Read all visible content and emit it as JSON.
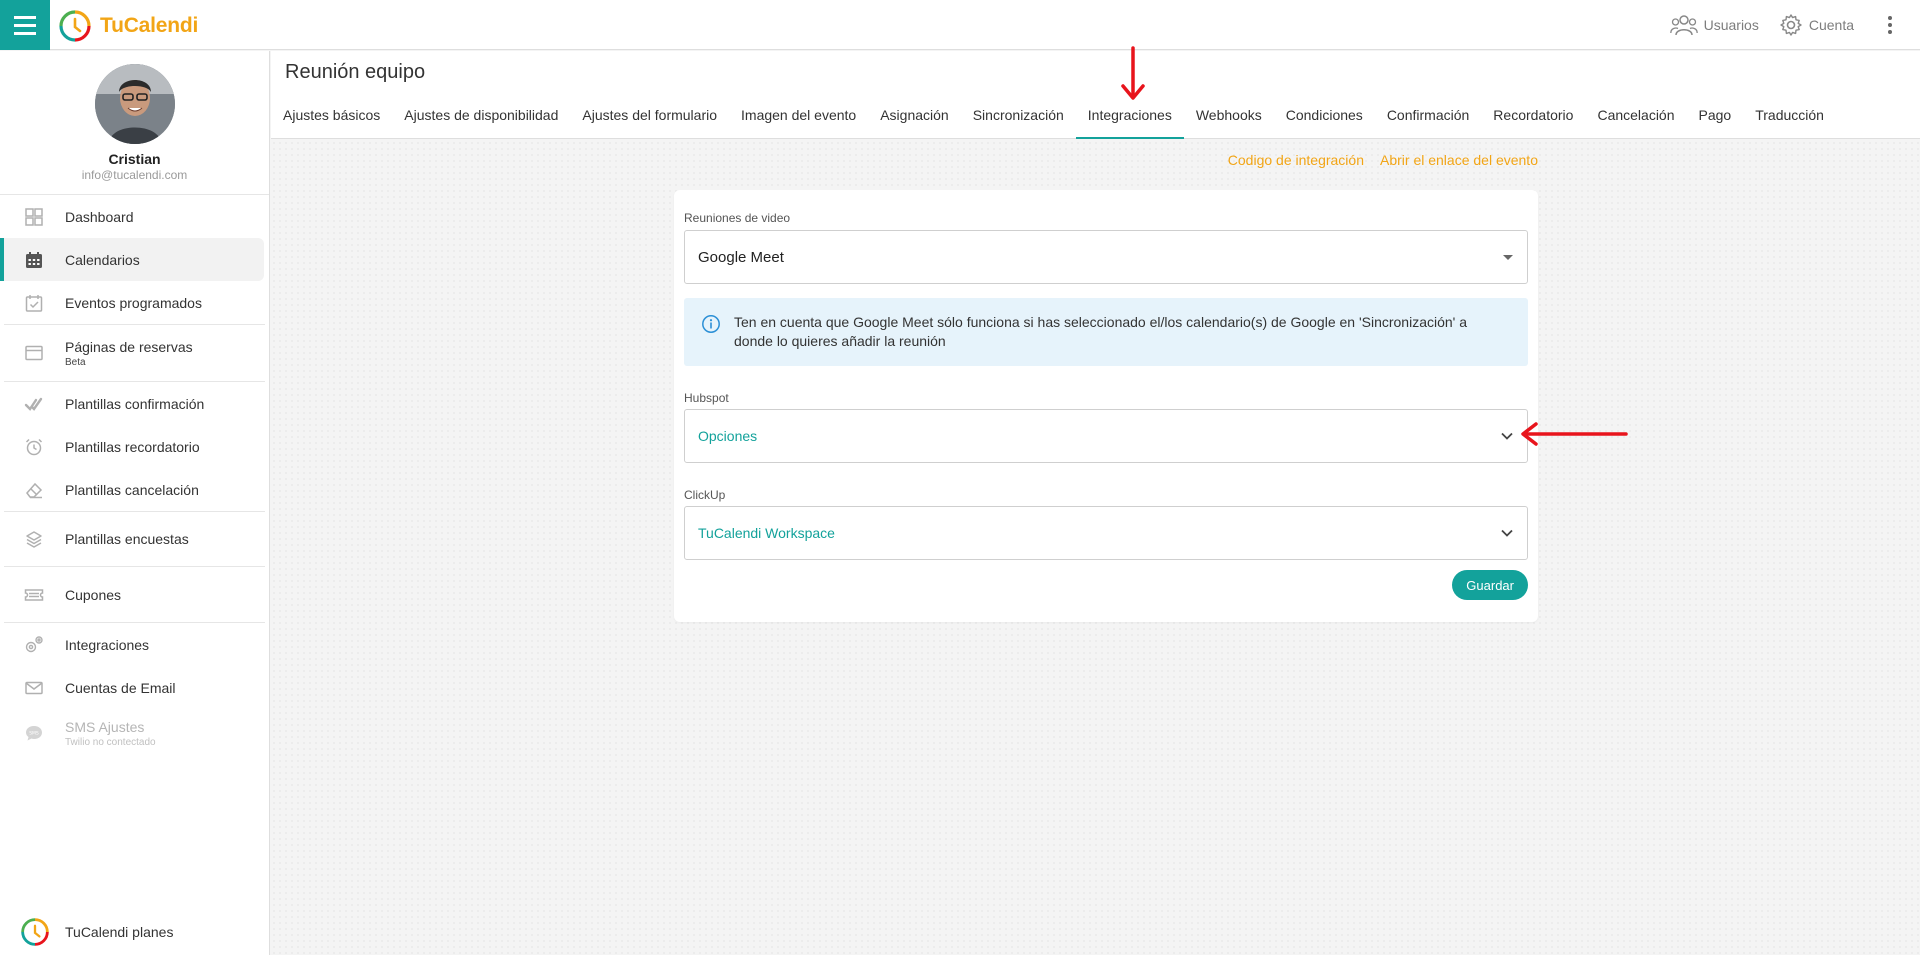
{
  "app": {
    "brand_part1": "TuCalend",
    "brand_part2": "i",
    "top_users": "Usuarios",
    "top_account": "Cuenta"
  },
  "profile": {
    "name": "Cristian",
    "email": "info@tucalendi.com"
  },
  "sidebar": {
    "items": [
      {
        "label": "Dashboard",
        "icon": "grid-icon"
      },
      {
        "label": "Calendarios",
        "icon": "calendar-icon",
        "active": true
      },
      {
        "label": "Eventos programados",
        "icon": "calendar-check-icon"
      },
      {
        "label": "Páginas de reservas",
        "sub": "Beta",
        "icon": "browser-window-icon"
      },
      {
        "label": "Plantillas confirmación",
        "icon": "double-check-icon"
      },
      {
        "label": "Plantillas recordatorio",
        "icon": "alarm-clock-icon"
      },
      {
        "label": "Plantillas cancelación",
        "icon": "eraser-icon"
      },
      {
        "label": "Plantillas encuestas",
        "icon": "layers-icon"
      },
      {
        "label": "Cupones",
        "icon": "ticket-icon"
      },
      {
        "label": "Integraciones",
        "icon": "gears-icon"
      },
      {
        "label": "Cuentas de Email",
        "icon": "envelope-icon"
      },
      {
        "label": "SMS Ajustes",
        "sub": "Twilio no contectado",
        "icon": "sms-bubble-icon",
        "disabled": true
      }
    ],
    "plans_label": "TuCalendi planes"
  },
  "page": {
    "title": "Reunión equipo",
    "tabs": [
      "Ajustes básicos",
      "Ajustes de disponibilidad",
      "Ajustes del formulario",
      "Imagen del evento",
      "Asignación",
      "Sincronización",
      "Integraciones",
      "Webhooks",
      "Condiciones",
      "Confirmación",
      "Recordatorio",
      "Cancelación",
      "Pago",
      "Traducción"
    ],
    "active_tab": "Integraciones"
  },
  "content": {
    "link_integration_code": "Codigo de integración",
    "link_open_event": "Abrir el enlace del evento",
    "video": {
      "label": "Reuniones de video",
      "value": "Google Meet"
    },
    "info_text": "Ten en cuenta que Google Meet sólo funciona si has seleccionado el/los calendario(s) de Google en 'Sincronización' a donde lo quieres añadir la reunión",
    "hubspot": {
      "label": "Hubspot",
      "value": "Opciones"
    },
    "clickup": {
      "label": "ClickUp",
      "value": "TuCalendi Workspace"
    },
    "save_label": "Guardar"
  },
  "colors": {
    "accent": "#13a29b",
    "brand_orange": "#f2a516",
    "annotation_red": "#e8141c",
    "info_bg": "#e6f3fb"
  }
}
